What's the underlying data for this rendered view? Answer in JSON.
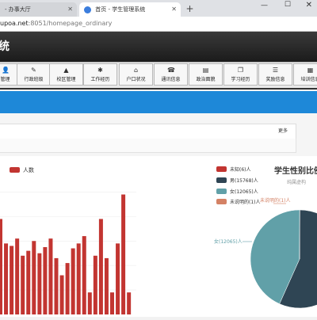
{
  "browser": {
    "tabs": [
      {
        "label": "- 办事大厅",
        "active": false
      },
      {
        "label": "首页 - 学生管理系统",
        "active": true
      }
    ],
    "new_tab": "+",
    "window": {
      "minimize": "—",
      "maximize": "☐",
      "close": "✕"
    },
    "url_host": "upoa.net",
    "url_path": ":8051/homepage_ordinary"
  },
  "header": {
    "logo_text": "统"
  },
  "nav": {
    "items": [
      {
        "label": "管理",
        "icon": "user-icon"
      },
      {
        "label": "行政班级",
        "icon": "edit-icon"
      },
      {
        "label": "校区管理",
        "icon": "building-icon"
      },
      {
        "label": "工作经历",
        "icon": "gear-icon"
      },
      {
        "label": "户口状况",
        "icon": "home-icon"
      },
      {
        "label": "通讯信息",
        "icon": "phone-icon"
      },
      {
        "label": "政治面貌",
        "icon": "document-icon"
      },
      {
        "label": "学习经历",
        "icon": "book-icon"
      },
      {
        "label": "奖励信息",
        "icon": "list-icon"
      },
      {
        "label": "培训信息",
        "icon": "training-icon"
      }
    ]
  },
  "notice": {
    "more_label": "更多"
  },
  "colors": {
    "bar": "#c23531",
    "blue_band": "#1e88d8",
    "pie_unknown": "#c23531",
    "pie_male": "#2f4554",
    "pie_female": "#61a0a8",
    "pie_unspecified": "#d48265"
  },
  "chart_data": [
    {
      "type": "bar",
      "legend": [
        "人数"
      ],
      "values": [
        78,
        58,
        56,
        62,
        48,
        52,
        60,
        50,
        55,
        62,
        46,
        32,
        42,
        54,
        58,
        64,
        18,
        48,
        78,
        46,
        18,
        58,
        98,
        18
      ],
      "ylim": [
        0,
        110
      ]
    },
    {
      "type": "pie",
      "title": "学生性别比例",
      "subtitle": "纯属虚构",
      "slices": [
        {
          "name": "未知",
          "value": 6,
          "legend": "未知(6)人"
        },
        {
          "name": "男",
          "value": 15768,
          "legend": "男(15768)人"
        },
        {
          "name": "女",
          "value": 12065,
          "legend": "女(12065)人"
        },
        {
          "name": "未说明的",
          "value": 1,
          "legend": "未说明的(1)人"
        }
      ],
      "slice_labels": [
        "未说明的(1)人",
        "女(12065)人"
      ]
    }
  ]
}
